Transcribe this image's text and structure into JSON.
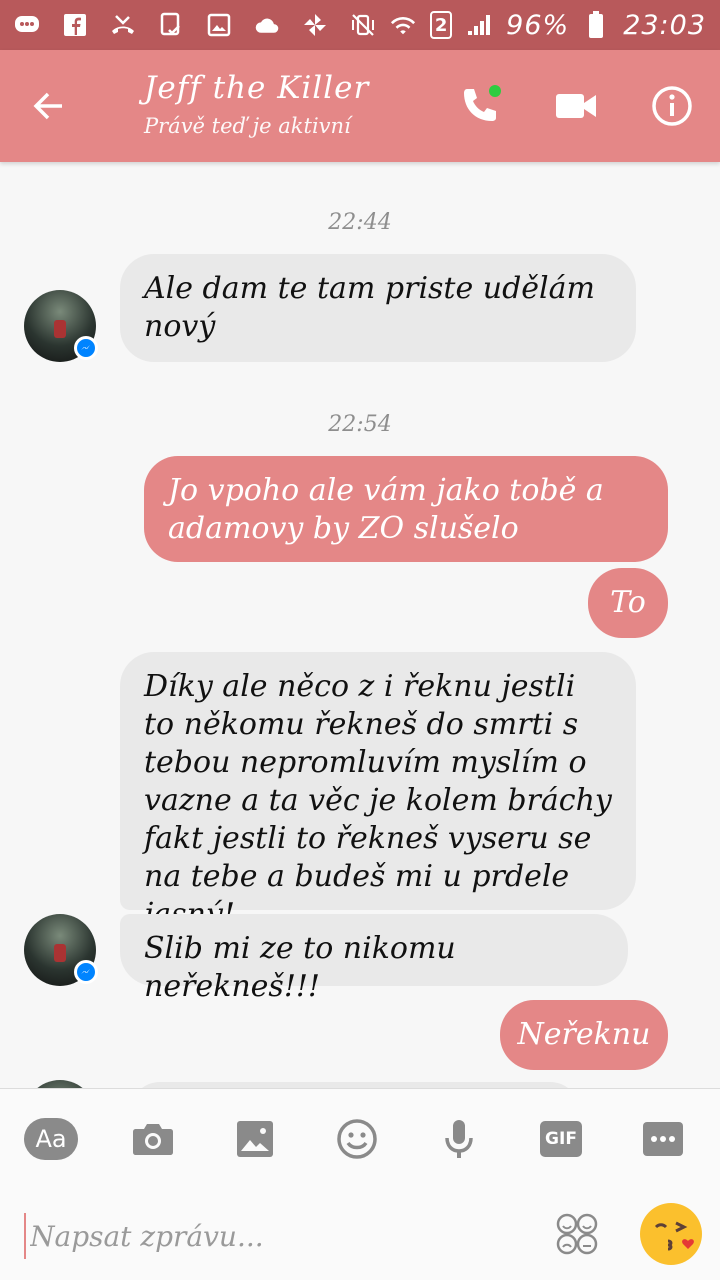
{
  "status_bar": {
    "sim_badge": "2",
    "battery": "96%",
    "time": "23:03"
  },
  "header": {
    "title": "Jeff the Killer",
    "subtitle": "Právě teď je aktivní"
  },
  "messages": [
    {
      "kind": "timestamp",
      "text": "22:44"
    },
    {
      "kind": "incoming",
      "text": "Ale dam te tam priste udělám nový"
    },
    {
      "kind": "timestamp",
      "text": "22:54"
    },
    {
      "kind": "outgoing",
      "text": "Jo vpoho ale vám jako tobě a adamovy by ZO slušelo"
    },
    {
      "kind": "outgoing",
      "text": "To"
    },
    {
      "kind": "incoming",
      "text": "Díky ale něco z i řeknu jestli to někomu řekneš do smrti s tebou nepromluvím myslím o vazne a ta věc je kolem bráchy fakt jestli to řekneš vyseru se na tebe a budeš mi u prdele jasný!"
    },
    {
      "kind": "incoming",
      "text": "Slib mi ze to nikomu neřekneš!!!"
    },
    {
      "kind": "outgoing",
      "text": "Neřeknu"
    }
  ],
  "composer": {
    "text_button_label": "Aa",
    "gif_label": "GIF",
    "placeholder": "Napsat zprávu..."
  },
  "colors": {
    "accent": "#e48787",
    "status_bar": "#b8595b",
    "incoming_bubble": "#e9e9e9",
    "online_dot": "#2ecc40",
    "messenger_badge": "#0084ff"
  }
}
